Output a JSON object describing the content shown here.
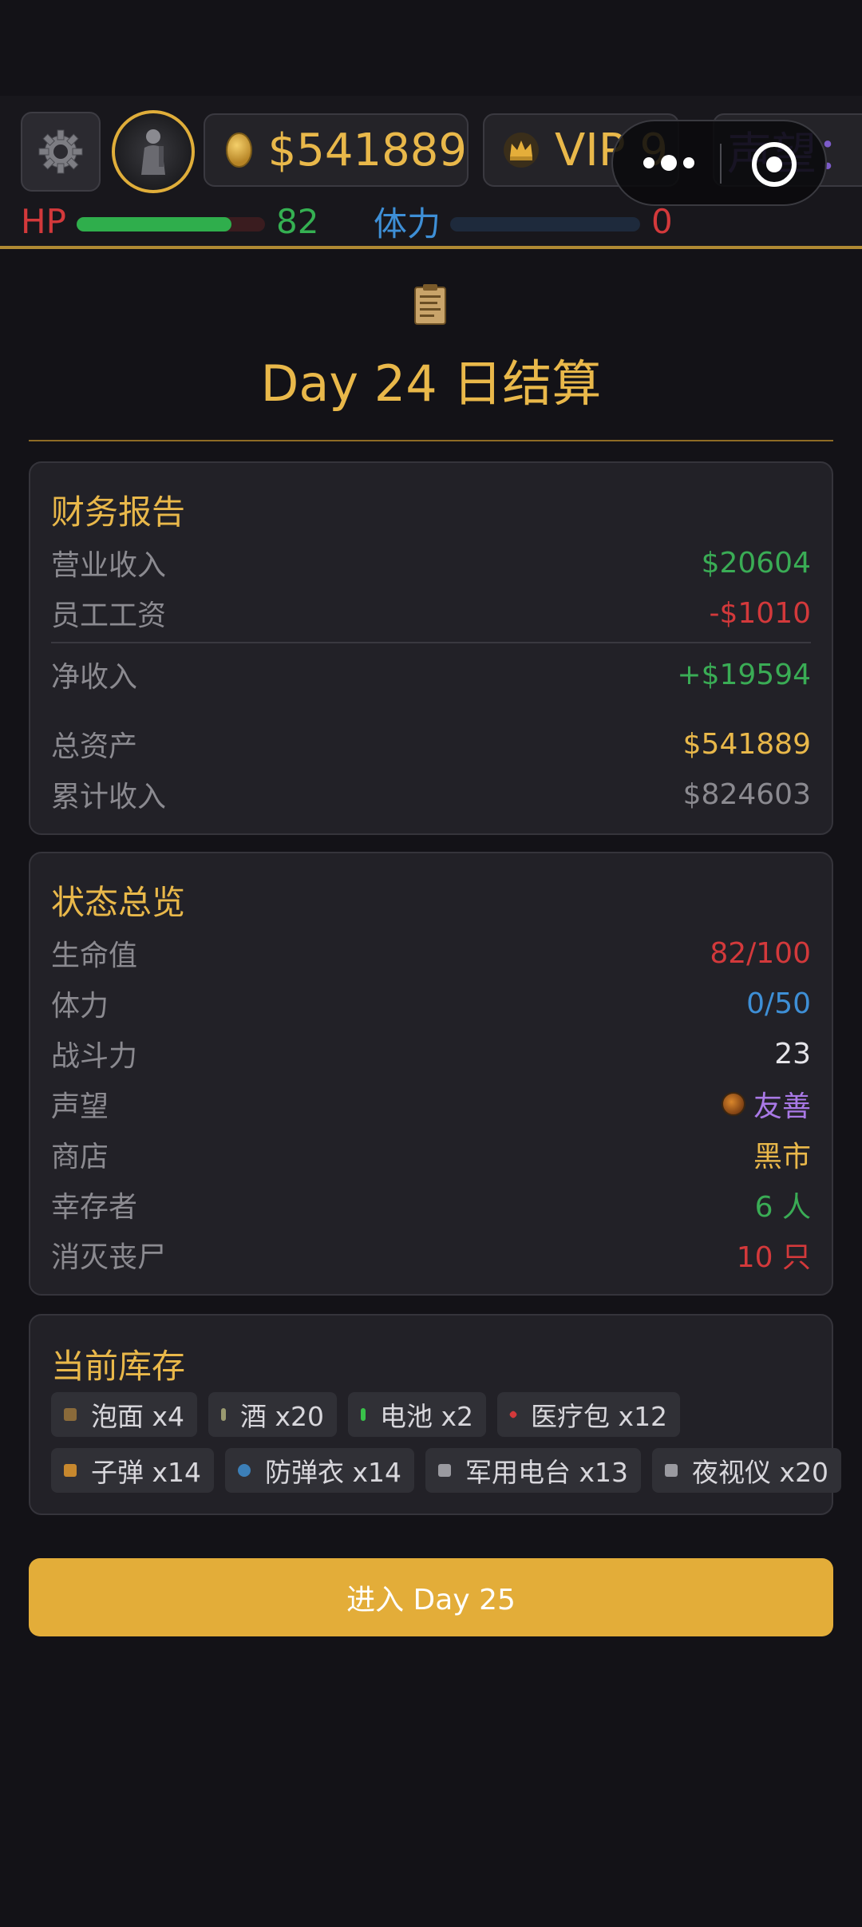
{
  "hud": {
    "money": "$541889",
    "vip": "VIP 9",
    "reputation_partial": "声望：",
    "hp_label": "HP",
    "hp_value": "82",
    "hp_fraction": 0.82,
    "stamina_label": "体力",
    "stamina_value": "0",
    "stamina_fraction": 0.0
  },
  "page": {
    "title": "Day 24 日结算"
  },
  "finance": {
    "title": "财务报告",
    "rows": [
      {
        "label": "营业收入",
        "value": "$20604",
        "color": "#3aac55"
      },
      {
        "label": "员工工资",
        "value": "-$1010",
        "color": "#d3393b"
      },
      {
        "label": "净收入",
        "value": "+$19594",
        "color": "#3aac55"
      },
      {
        "label": "总资产",
        "value": "$541889",
        "color": "#e9b84a"
      },
      {
        "label": "累计收入",
        "value": "$824603",
        "color": "#8b8a90"
      }
    ]
  },
  "status": {
    "title": "状态总览",
    "rows": [
      {
        "label": "生命值",
        "value": "82/100",
        "color": "#d3393b"
      },
      {
        "label": "体力",
        "value": "0/50",
        "color": "#3e8fd6"
      },
      {
        "label": "战斗力",
        "value": "23",
        "color": "#e6e5ea"
      },
      {
        "label": "声望",
        "value": "友善",
        "color": "#a979e6",
        "icon": "reputation-medal-icon"
      },
      {
        "label": "商店",
        "value": "黑市",
        "color": "#e9b84a"
      },
      {
        "label": "幸存者",
        "value": "6 人",
        "color": "#3aac55"
      },
      {
        "label": "消灭丧尸",
        "value": "10 只",
        "color": "#d3393b"
      }
    ]
  },
  "inventory": {
    "title": "当前库存",
    "items": [
      {
        "label": "泡面 x4",
        "icon": "noodle-icon",
        "color": "#8a6a3a"
      },
      {
        "label": "酒 x20",
        "icon": "wine-bottle-icon",
        "color": "#9a9a70"
      },
      {
        "label": "电池 x2",
        "icon": "battery-icon",
        "color": "#39c24a"
      },
      {
        "label": "医疗包 x12",
        "icon": "medkit-icon",
        "color": "#d3393b"
      },
      {
        "label": "子弹 x14",
        "icon": "bullet-icon",
        "color": "#c7882e"
      },
      {
        "label": "防弹衣 x14",
        "icon": "body-armor-icon",
        "color": "#3c7fb8"
      },
      {
        "label": "军用电台 x13",
        "icon": "radio-icon",
        "color": "#9a9aa0"
      },
      {
        "label": "夜视仪 x20",
        "icon": "night-vision-icon",
        "color": "#9a9aa0"
      }
    ]
  },
  "action": {
    "next_day": "进入 Day 25"
  }
}
